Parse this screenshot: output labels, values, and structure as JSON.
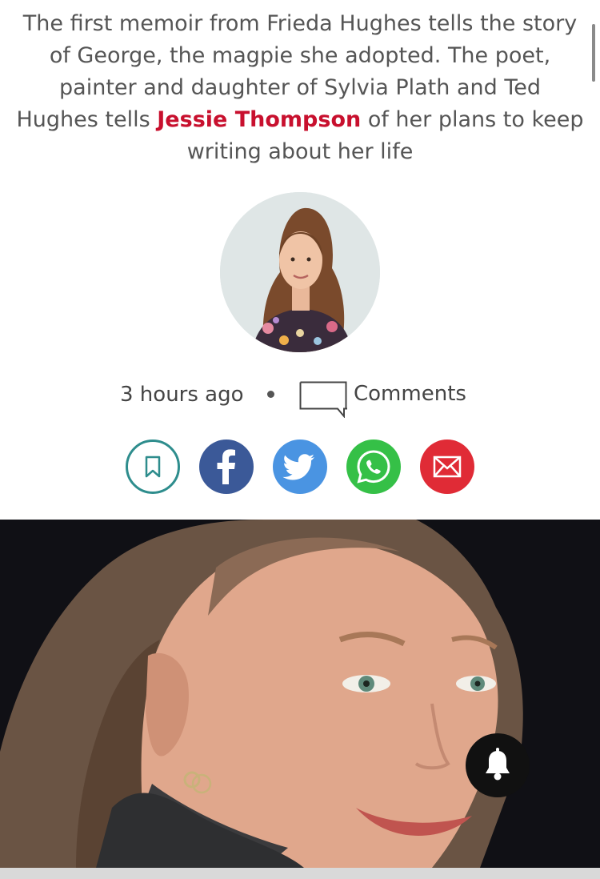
{
  "article": {
    "standfirst_before": "The first memoir from Frieda Hughes tells the story of George, the magpie she adopted. The poet, painter and daughter of Sylvia Plath and Ted Hughes tells ",
    "author_name": "Jessie Thompson",
    "standfirst_after": " of her plans to keep writing about her life"
  },
  "meta": {
    "time_ago": "3 hours ago",
    "comments_label": "Comments"
  },
  "share": {
    "buttons": [
      "bookmark-icon",
      "facebook-icon",
      "twitter-icon",
      "whatsapp-icon",
      "email-icon"
    ]
  },
  "colors": {
    "author_link": "#c8102e",
    "bookmark": "#2e8d8d",
    "facebook": "#3b5998",
    "twitter": "#4a94e2",
    "whatsapp": "#35c047",
    "email": "#e02b36"
  },
  "notifications": {
    "icon": "bell-icon"
  }
}
